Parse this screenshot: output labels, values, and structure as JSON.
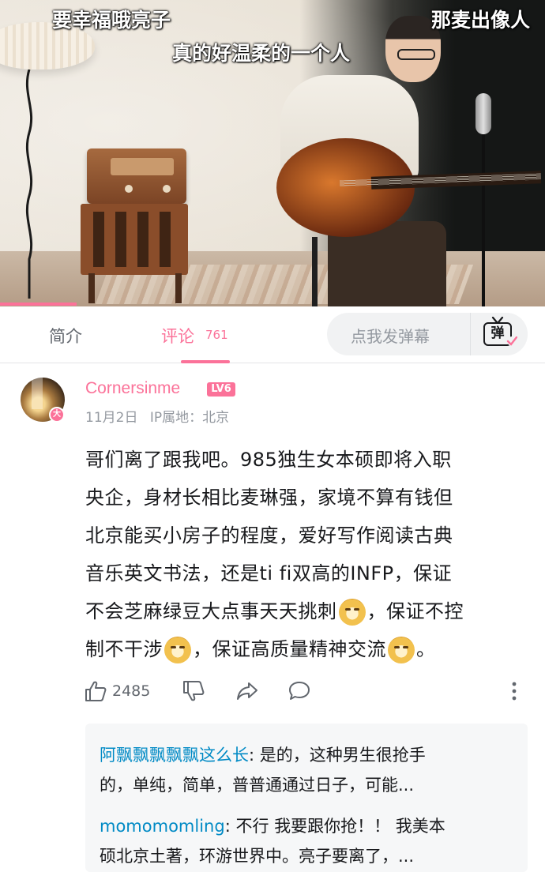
{
  "video": {
    "overlay_comments": [
      "要幸福哦亮子",
      "那麦出像人",
      "真的好温柔的一个人"
    ],
    "progress": 0.14
  },
  "tabs": {
    "intro_label": "简介",
    "comments_label": "评论",
    "comments_count": "761",
    "danmaku_placeholder": "点我发弹幕",
    "danmaku_icon_text": "弹"
  },
  "comment": {
    "username": "Cornersinme",
    "level": "LV6",
    "avatar_badge": "大",
    "date": "11月2日",
    "ip_label": "IP属地：北京",
    "lines": [
      "哥们离了跟我吧。985独生女本硕即将入职",
      "央企，身材长相比麦琳强，家境不算有钱但",
      "北京能买小房子的程度，爱好写作阅读古典",
      "音乐英文书法，还是ti fi双高的INFP，保证",
      "不会芝麻绿豆大点事天天挑刺",
      "，保证不控",
      "制不干涉",
      "，保证高质量精神交流",
      "。"
    ],
    "like_count": "2485"
  },
  "replies": [
    {
      "name": "阿飘飘飘飘飘这么长",
      "text_line1": ": 是的，这种男生很抢手",
      "text_line2": "的，单纯，简单，普普通通过日子，可能..."
    },
    {
      "name": "momomomling",
      "text_line1": ": 不行 我要跟你抢！！ 我美本",
      "text_line2": "硕北京土著，环游世界中。亮子要离了，..."
    }
  ],
  "colors": {
    "accent": "#fb7299",
    "reply_name": "#008ac5",
    "muted": "#9499a0"
  }
}
